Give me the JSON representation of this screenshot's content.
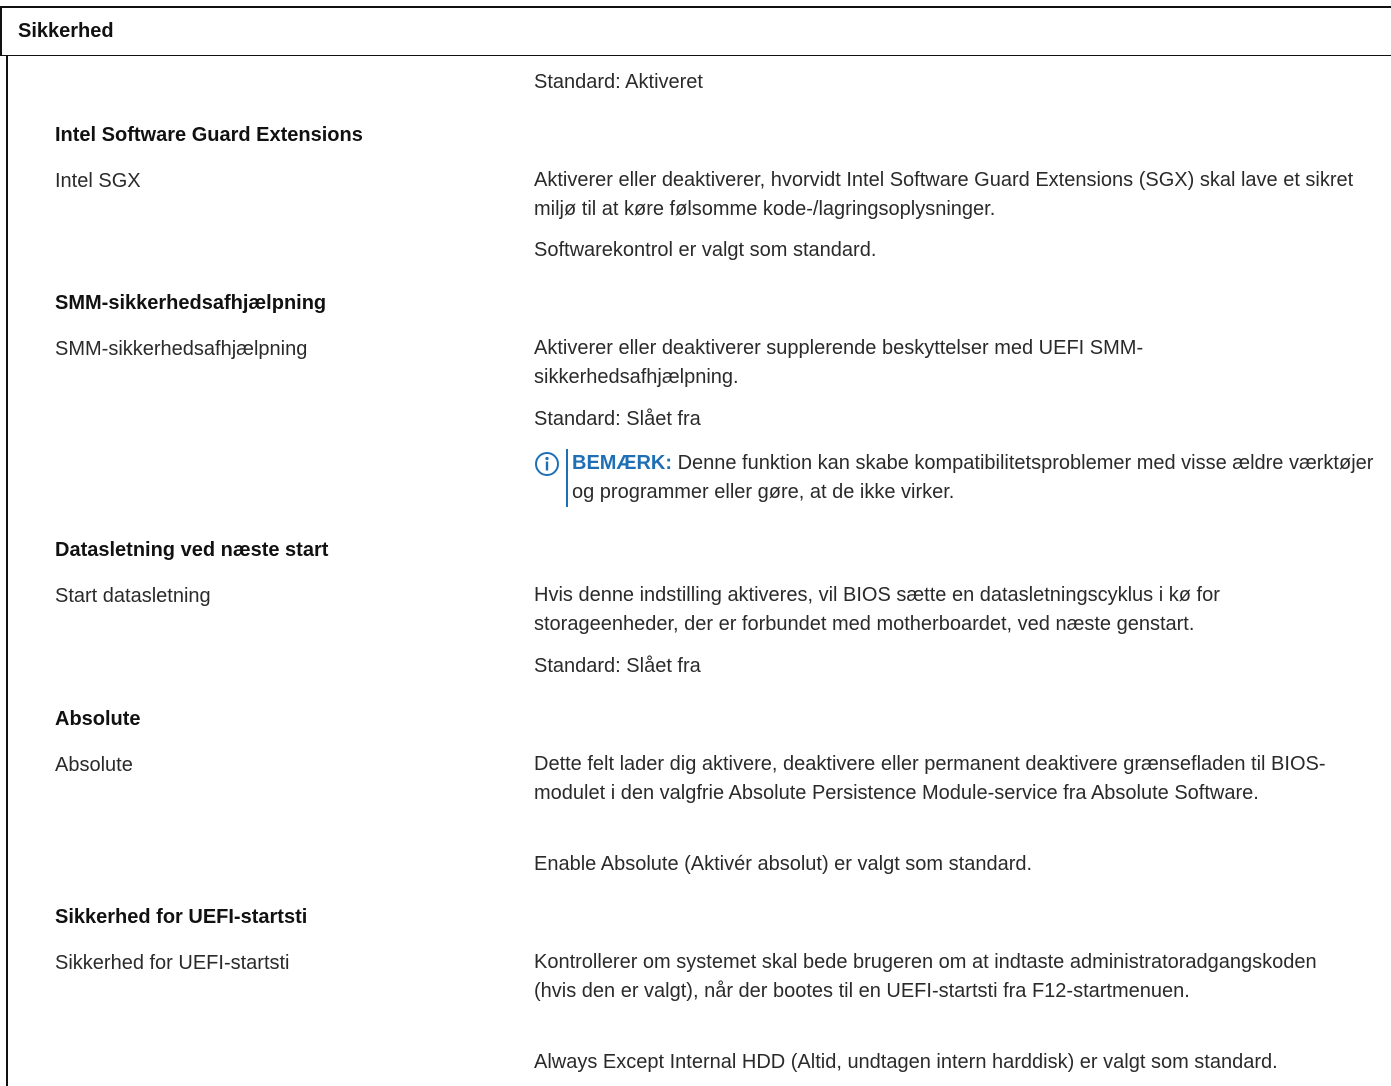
{
  "header": {
    "title": "Sikkerhed"
  },
  "top": {
    "default_text": "Standard: Aktiveret"
  },
  "sections": {
    "sgx": {
      "heading": "Intel Software Guard Extensions",
      "label": "Intel SGX",
      "description": "Aktiverer eller deaktiverer, hvorvidt Intel Software Guard Extensions (SGX) skal lave et sikret miljø til at køre følsomme kode-/lagringsoplysninger.",
      "default_text": "Softwarekontrol er valgt som standard."
    },
    "smm": {
      "heading": "SMM-sikkerhedsafhjælpning",
      "label": "SMM-sikkerhedsafhjælpning",
      "description": "Aktiverer eller deaktiverer supplerende beskyttelser med UEFI SMM-sikkerhedsafhjælpning.",
      "default_text": "Standard: Slået fra",
      "note_label": "BEMÆRK:",
      "note_text": "Denne funktion kan skabe kompatibilitetsproblemer med visse ældre værktøjer og programmer eller gøre, at de ikke virker.",
      "note_icon": "info-icon"
    },
    "wipe": {
      "heading": "Datasletning ved næste start",
      "label": "Start datasletning",
      "description": "Hvis denne indstilling aktiveres, vil BIOS sætte en datasletningscyklus i kø for storageenheder, der er forbundet med motherboardet, ved næste genstart.",
      "default_text": "Standard: Slået fra"
    },
    "absolute": {
      "heading": "Absolute",
      "label": "Absolute",
      "description": "Dette felt lader dig aktivere, deaktivere eller permanent deaktivere grænsefladen til BIOS-modulet i den valgfrie Absolute Persistence Module-service fra Absolute Software.",
      "default_text": "Enable Absolute (Aktivér absolut) er valgt som standard."
    },
    "uefi": {
      "heading": "Sikkerhed for UEFI-startsti",
      "label": "Sikkerhed for UEFI-startsti",
      "description": "Kontrollerer om systemet skal bede brugeren om at indtaste administratoradgangskoden (hvis den er valgt), når der bootes til en UEFI-startsti fra F12-startmenuen.",
      "default_text": "Always Except Internal HDD (Altid, undtagen intern harddisk) er valgt som standard."
    }
  },
  "colors": {
    "accent": "#1f6fb5",
    "text": "#2a2a2a"
  }
}
